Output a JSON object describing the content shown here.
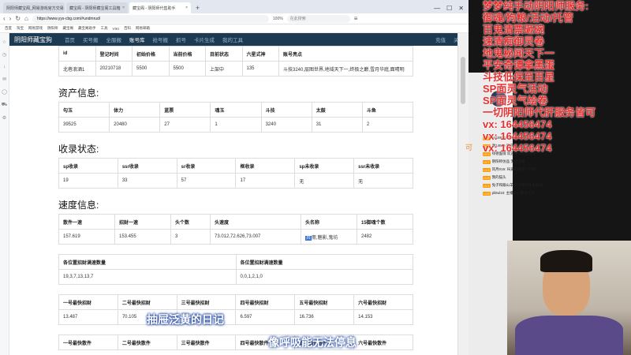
{
  "browser": {
    "tabs": [
      {
        "label": "阴阳师藏宝阁_网易游戏官方交易"
      },
      {
        "label": "藏宝阁 - 阴阳师藏宝阁工具箱"
      },
      {
        "label": "藏宝阁 - 阴阳师代售助手"
      }
    ],
    "url": "https://www.yys-cbg.com/#undmrud/",
    "search_placeholder": "在此搜索",
    "zoom": "100%",
    "bookmarks": [
      "百度",
      "淘宝",
      "网易游戏",
      "阴阳师",
      "藏宝阁",
      "藏宝阁助手",
      "工具",
      "VIKI",
      "百科",
      "网易邮箱"
    ]
  },
  "site": {
    "brand": "阴阳师藏宝狗",
    "nav": [
      "首页",
      "买号搬",
      "全服搬",
      "账号库",
      "抢号搬",
      "抓号",
      "卡片生成",
      "我的工具"
    ],
    "active_index": 3,
    "right": [
      "充值",
      "关于"
    ]
  },
  "account": {
    "headers": [
      "id",
      "登记时间",
      "初始价格",
      "当前价格",
      "目前状态",
      "六星式神",
      "账号亮点"
    ],
    "row": [
      "北巷浪酒1",
      "20210718",
      "5500",
      "5500",
      "上架中",
      "135",
      "斗技3240,层图世界,地域天下一,终极之巅,雪月华庭,面晴明"
    ]
  },
  "assets": {
    "title": "资产信息:",
    "headers": [
      "勾玉",
      "体力",
      "蓝票",
      "魂玉",
      "斗技",
      "太鼓",
      "斗鱼"
    ],
    "row": [
      "39525",
      "20480",
      "27",
      "1",
      "3240",
      "31",
      "2"
    ]
  },
  "collection": {
    "title": "收录状态:",
    "headers": [
      "sp收录",
      "ssr收录",
      "sr收录",
      "框收录",
      "sp未收录",
      "ssr未收录"
    ],
    "row": [
      "19",
      "33",
      "57",
      "17",
      "无",
      "无"
    ]
  },
  "speed": {
    "title": "速度信息:",
    "headers": [
      "散件一速",
      "招财一速",
      "头个数",
      "头速度",
      "头名称",
      "15御魂个数"
    ],
    "row": [
      "157.619",
      "153.455",
      "3",
      "73.012,72.626,73.007",
      "",
      "2482"
    ],
    "name_selected": "兵",
    "name_rest": "斋,魅影,鬼坊"
  },
  "counts": {
    "headers": [
      "各位置招财满速数量",
      "各位置招财满速数量"
    ],
    "row": [
      "19,3,7,13,13,7",
      "0,0,1,2,1,0"
    ]
  },
  "zhaocai": {
    "headers": [
      "一号最快招财",
      "二号最快招财",
      "三号最快招财",
      "四号最快招财",
      "五号最快招财",
      "六号最快招财"
    ],
    "row": [
      "13.487",
      "70.105",
      "",
      "6.597",
      "16.736",
      "14.153"
    ]
  },
  "sanjian": {
    "headers": [
      "一号最快散件",
      "二号最快散件",
      "三号最快散件",
      "四号最快散件",
      "五号最快散件",
      "六号最快散件"
    ]
  },
  "stream_overlay": {
    "lines": [
      "梦梦纯手动阴阳师服务:",
      "御魂/狗粮/活动/托管",
      "百鬼清票砸碗",
      "速清痴御灵卷",
      "地鬼秘闻天下一",
      "平安奇谭拿黑蛋",
      "斗技低保至百星",
      "SP面灵气活动",
      "SP面灵气绘卷",
      "一切阴阳师代肝服务皆可",
      "vx: 164456474",
      "vx: 164456474",
      "vx: 164456474"
    ]
  },
  "captions": {
    "main": "抽屉泛黄的日记",
    "sub": "像呼吸能无法停息"
  },
  "chat": [
    {
      "badge": "LV.9",
      "text": "641897196 欢迎来到本直播间"
    },
    {
      "badge": "LV.5",
      "text": "谢14685 欢迎来到直播间"
    },
    {
      "badge": "LV.2",
      "text": "绿德面情 欢迎来到本直播间"
    },
    {
      "badge": "LV.7",
      "text": "阴阳师仿品 无需主播"
    },
    {
      "badge": "LV.3",
      "text": "风月016: 咔满等我想一万喔"
    },
    {
      "badge": "LV.8",
      "text": "我的猫头"
    },
    {
      "badge": "LV.4",
      "text": "兔子和跟山羊 欢迎来到本直播间"
    },
    {
      "badge": "LV.6",
      "text": "pli8ul10: 主播小小娜怎么玩"
    }
  ],
  "orange_text": "可"
}
